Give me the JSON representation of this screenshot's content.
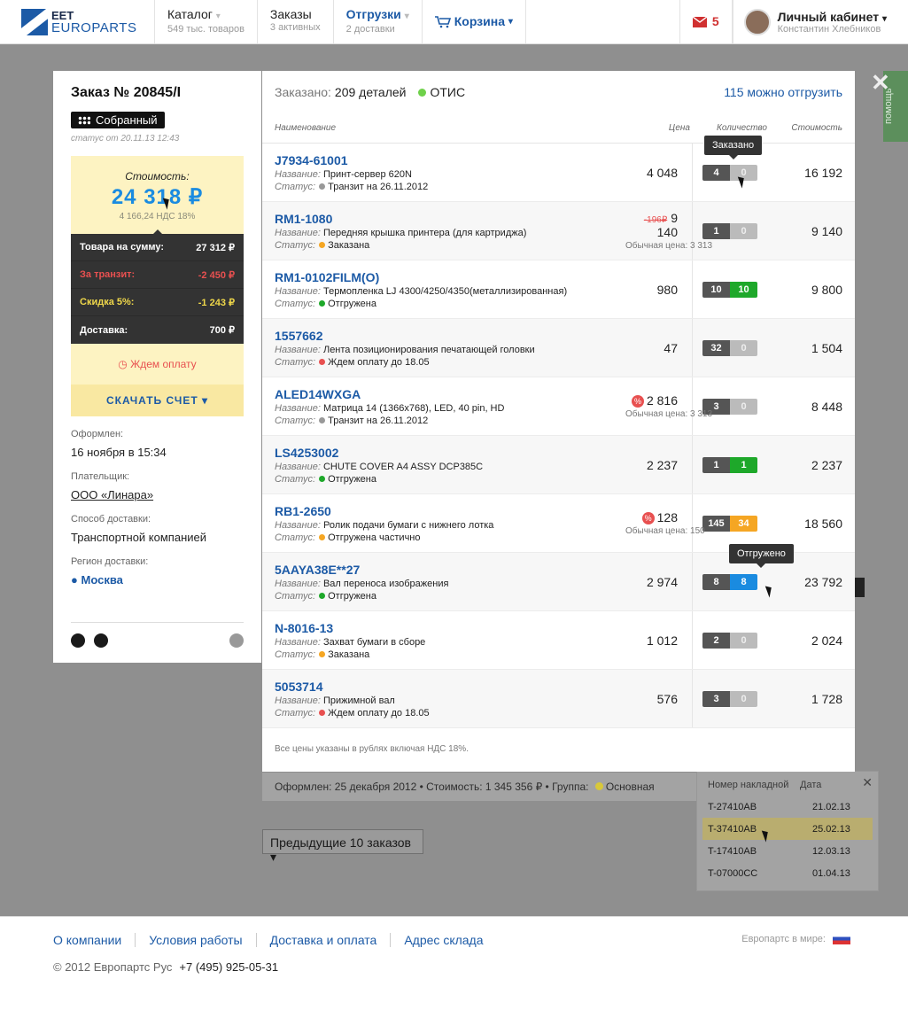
{
  "header": {
    "logo_line1": "EET",
    "logo_line2": "EUROPARTS",
    "catalog_label": "Каталог",
    "catalog_sub": "549 тыс. товаров",
    "orders_label": "Заказы",
    "orders_sub": "3 активных",
    "shipments_label": "Отгрузки",
    "shipments_sub": "2 доставки",
    "cart_label": "Корзина",
    "mail_count": "5",
    "account_label": "Личный кабинет",
    "account_name": "Константин Хлебников"
  },
  "help_label": "помощь",
  "order": {
    "title": "Заказ № 20845/I",
    "status": "Собранный",
    "status_date": "статус от 20.11.13 12:43",
    "cost_label": "Стоимость:",
    "cost_value": "24 318 ₽",
    "vat": "4 166,24 НДС 18%",
    "summary": [
      {
        "label": "Товара на сумму:",
        "value": "27 312 ₽",
        "tone": "normal"
      },
      {
        "label": "За транзит:",
        "value": "-2 450 ₽",
        "tone": "red"
      },
      {
        "label": "Скидка 5%:",
        "value": "-1 243 ₽",
        "tone": "yellow"
      },
      {
        "label": "Доставка:",
        "value": "700 ₽",
        "tone": "normal"
      }
    ],
    "wait_label": "Ждем оплату",
    "download_label": "СКАЧАТЬ СЧЕТ ▾",
    "placed_label": "Оформлен:",
    "placed_value": "16 ноября в 15:34",
    "payer_label": "Плательщик:",
    "payer_value": "ООО «Линара»",
    "delivery_label": "Способ доставки:",
    "delivery_value": "Транспортной компанией",
    "region_label": "Регион доставки:",
    "region_value": "Москва"
  },
  "table": {
    "ordered_label": "Заказано:",
    "ordered_value": "209 деталей",
    "otis_label": "ОТИС",
    "can_ship": "115 можно отгрузить",
    "col_name": "Наименование",
    "col_price": "Цена",
    "col_qty": "Количество",
    "col_cost": "Стоимость",
    "name_prefix": "Название:",
    "status_prefix": "Статус:",
    "usual_prefix": "Обычная цена:",
    "rows": [
      {
        "article": "J7934-61001",
        "name": "Принт-сервер 620N",
        "status": "Транзит на 26.11.2012",
        "status_color": "#999999",
        "price": "4 048",
        "old_price": "",
        "usual_price": "",
        "discount": false,
        "qty_ordered": "4",
        "qty_shipped": "0",
        "qty_tone": "gray",
        "cost": "16 192"
      },
      {
        "article": "RM1-1080",
        "name": "Передняя крышка принтера (для картриджа)",
        "status": "Заказана",
        "status_color": "#f5a623",
        "price": "9 140",
        "old_price": "-196₽",
        "usual_price": "3 313",
        "discount": false,
        "qty_ordered": "1",
        "qty_shipped": "0",
        "qty_tone": "gray",
        "cost": "9 140"
      },
      {
        "article": "RM1-0102FILM(O)",
        "name": "Термопленка LJ 4300/4250/4350(металлизированная)",
        "status": "Отгружена",
        "status_color": "#1ea82a",
        "price": "980",
        "old_price": "",
        "usual_price": "",
        "discount": false,
        "qty_ordered": "10",
        "qty_shipped": "10",
        "qty_tone": "green",
        "cost": "9 800"
      },
      {
        "article": "1557662",
        "name": "Лента позиционирования печатающей головки",
        "status": "Ждем оплату до 18.05",
        "status_color": "#e85050",
        "price": "47",
        "old_price": "",
        "usual_price": "",
        "discount": false,
        "qty_ordered": "32",
        "qty_shipped": "0",
        "qty_tone": "gray",
        "cost": "1 504"
      },
      {
        "article": "ALED14WXGA",
        "name": "Матрица 14 (1366x768), LED, 40 pin, HD",
        "status": "Транзит на 26.11.2012",
        "status_color": "#999999",
        "price": "2 816",
        "old_price": "",
        "usual_price": "3 313",
        "discount": true,
        "qty_ordered": "3",
        "qty_shipped": "0",
        "qty_tone": "gray",
        "cost": "8 448"
      },
      {
        "article": "LS4253002",
        "name": "CHUTE COVER A4 ASSY DCP385C",
        "status": "Отгружена",
        "status_color": "#1ea82a",
        "price": "2 237",
        "old_price": "",
        "usual_price": "",
        "discount": false,
        "qty_ordered": "1",
        "qty_shipped": "1",
        "qty_tone": "green",
        "cost": "2 237"
      },
      {
        "article": "RB1-2650",
        "name": "Ролик подачи бумаги с нижнего лотка",
        "status": "Отгружена частично",
        "status_color": "#f5a623",
        "price": "128",
        "old_price": "",
        "usual_price": "150",
        "discount": true,
        "qty_ordered": "145",
        "qty_shipped": "34",
        "qty_tone": "orange",
        "cost": "18 560"
      },
      {
        "article": "5AAYA38E**27",
        "name": "Вал переноса изображения",
        "status": "Отгружена",
        "status_color": "#1ea82a",
        "price": "2 974",
        "old_price": "",
        "usual_price": "",
        "discount": false,
        "qty_ordered": "8",
        "qty_shipped": "8",
        "qty_tone": "blue",
        "cost": "23 792"
      },
      {
        "article": "N-8016-13",
        "name": "Захват бумаги в сборе",
        "status": "Заказана",
        "status_color": "#f5a623",
        "price": "1 012",
        "old_price": "",
        "usual_price": "",
        "discount": false,
        "qty_ordered": "2",
        "qty_shipped": "0",
        "qty_tone": "gray",
        "cost": "2 024"
      },
      {
        "article": "5053714",
        "name": "Прижимной вал",
        "status": "Ждем оплату до 18.05",
        "status_color": "#e85050",
        "price": "576",
        "old_price": "",
        "usual_price": "",
        "discount": false,
        "qty_ordered": "3",
        "qty_shipped": "0",
        "qty_tone": "gray",
        "cost": "1 728"
      }
    ],
    "footnote": "Все цены указаны в рублях включая НДС 18%.",
    "tooltip_ordered": "Заказано",
    "tooltip_shipped": "Отгружено",
    "discount_icon": "%"
  },
  "background": {
    "order_line": "Оформлен: 25 декабря 2012  •  Стоимость: 1 345 356 ₽  •  Группа:",
    "group_value": "Основная",
    "prev_button": "Предыдущие 10 заказов ▾"
  },
  "waybill": {
    "col_number": "Номер накладной",
    "col_date": "Дата",
    "rows": [
      {
        "number": "T-27410AB",
        "date": "21.02.13"
      },
      {
        "number": "T-37410AB",
        "date": "25.02.13"
      },
      {
        "number": "T-17410AB",
        "date": "12.03.13"
      },
      {
        "number": "T-07000CC",
        "date": "01.04.13"
      }
    ]
  },
  "footer": {
    "links": [
      "О компании",
      "Условия работы",
      "Доставка и оплата",
      "Адрес склада"
    ],
    "world_label": "Европартс в мире:",
    "copyright": "© 2012 Европартс Рус",
    "phone": "+7 (495) 925-05-31"
  }
}
